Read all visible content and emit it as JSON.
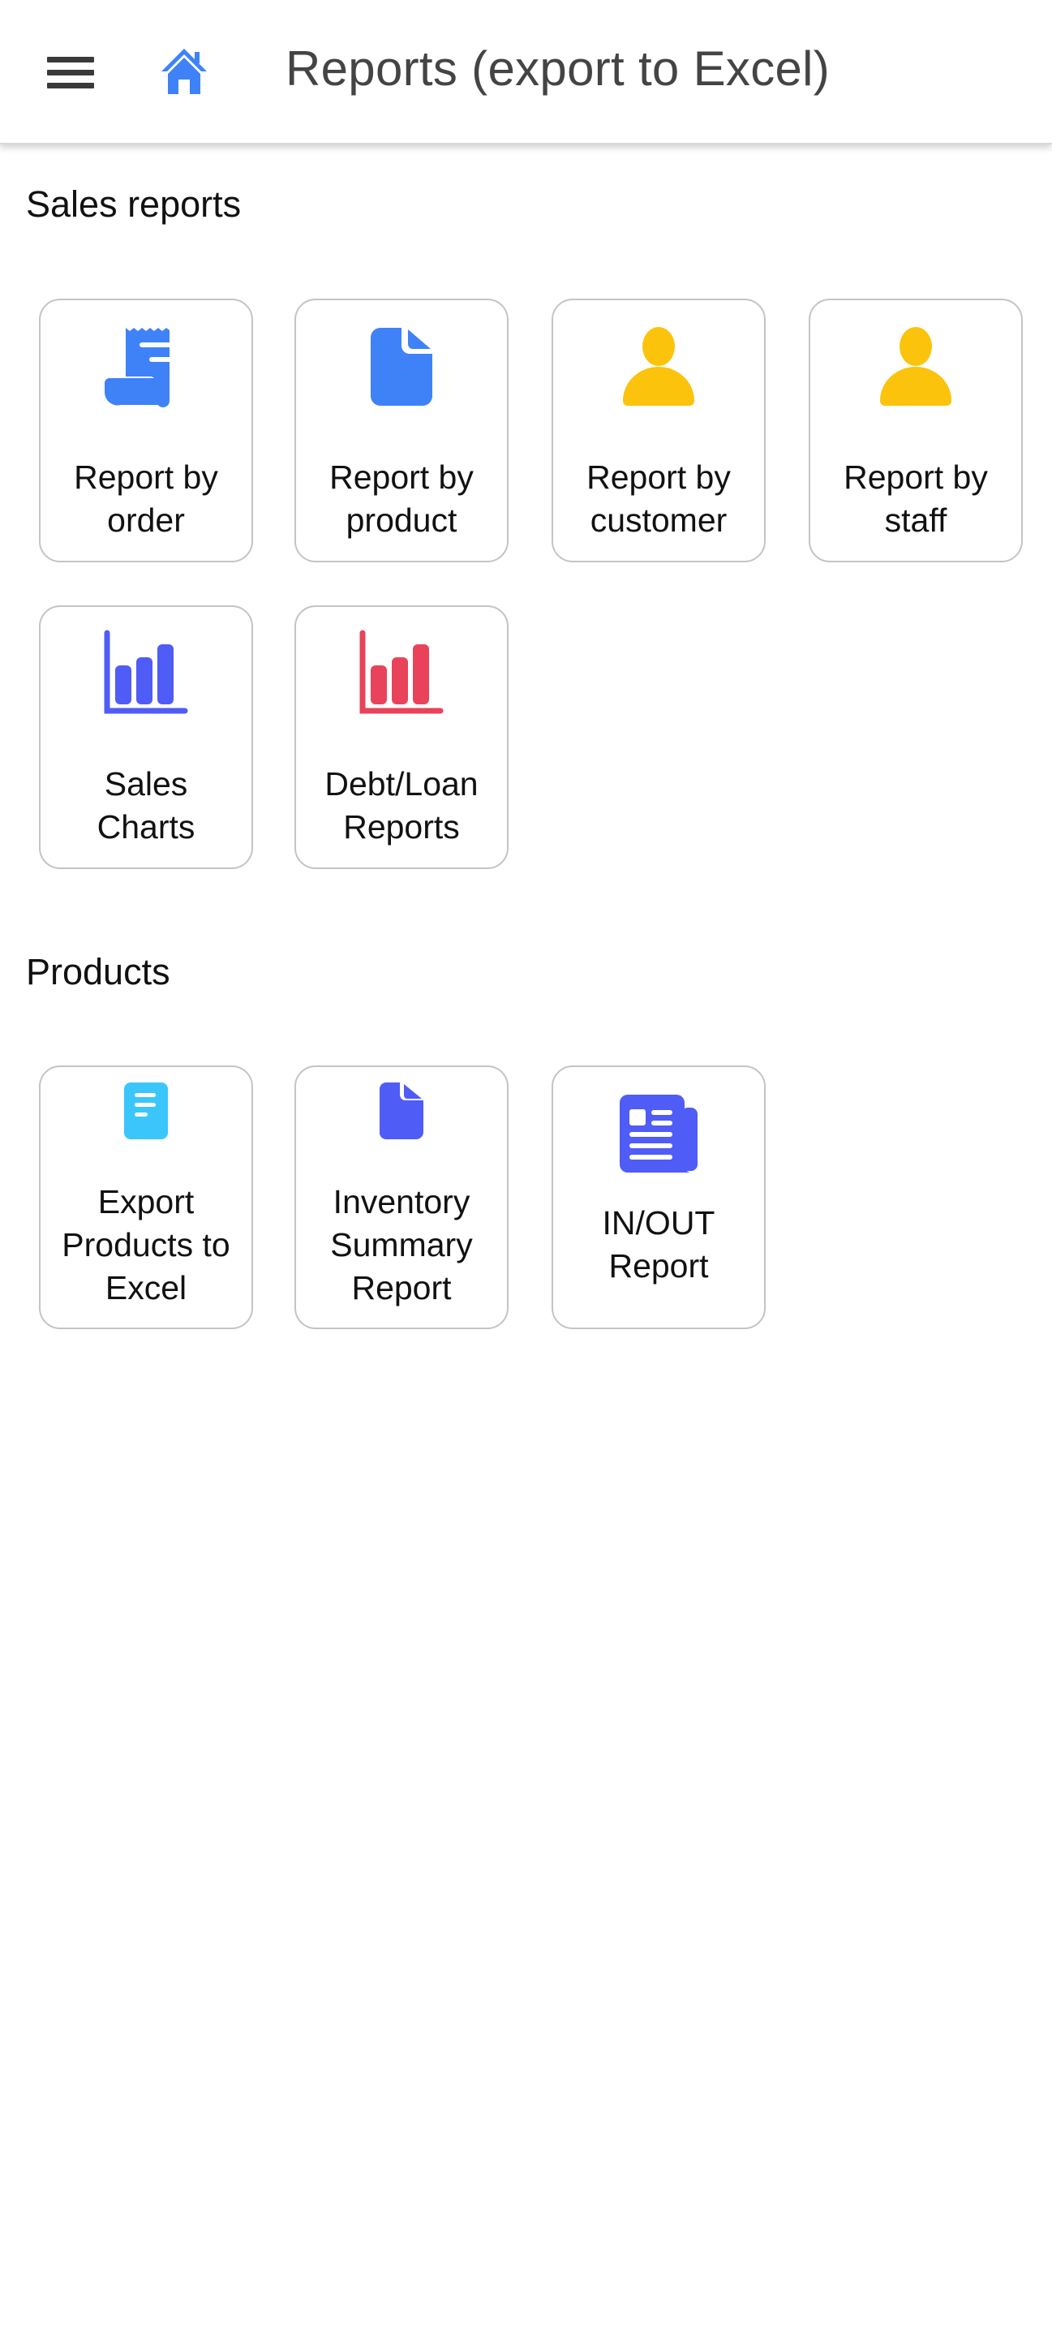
{
  "header": {
    "title": "Reports (export to Excel)",
    "menu_icon": "hamburger-menu-icon",
    "home_icon": "home-icon"
  },
  "colors": {
    "home": "#3f82f8",
    "blue": "#3f82f8",
    "yellow": "#fcc30c",
    "indigo": "#4f5cf5",
    "red": "#e8435a",
    "cyan": "#3ac6fb",
    "card_border": "#c4c4c4"
  },
  "sections": [
    {
      "title": "Sales reports",
      "items": [
        {
          "label_line1": "Report by",
          "label_line2": "order",
          "icon": "receipt-icon"
        },
        {
          "label_line1": "Report by",
          "label_line2": "product",
          "icon": "file-icon"
        },
        {
          "label_line1": "Report by",
          "label_line2": "customer",
          "icon": "user-icon"
        },
        {
          "label_line1": "Report by",
          "label_line2": "staff",
          "icon": "user-icon"
        },
        {
          "label_line1": "Sales",
          "label_line2": "Charts",
          "icon": "bar-chart-icon"
        },
        {
          "label_line1": "Debt/Loan",
          "label_line2": "Reports",
          "icon": "bar-chart-icon"
        }
      ]
    },
    {
      "title": "Products",
      "items": [
        {
          "label_line1": "Export",
          "label_line2": "Products to",
          "label_line3": "Excel",
          "icon": "document-text-icon"
        },
        {
          "label_line1": "Inventory",
          "label_line2": "Summary",
          "label_line3": "Report",
          "icon": "file-icon"
        },
        {
          "label_line1": "IN/OUT",
          "label_line2": "Report",
          "icon": "newspaper-icon"
        }
      ]
    }
  ]
}
